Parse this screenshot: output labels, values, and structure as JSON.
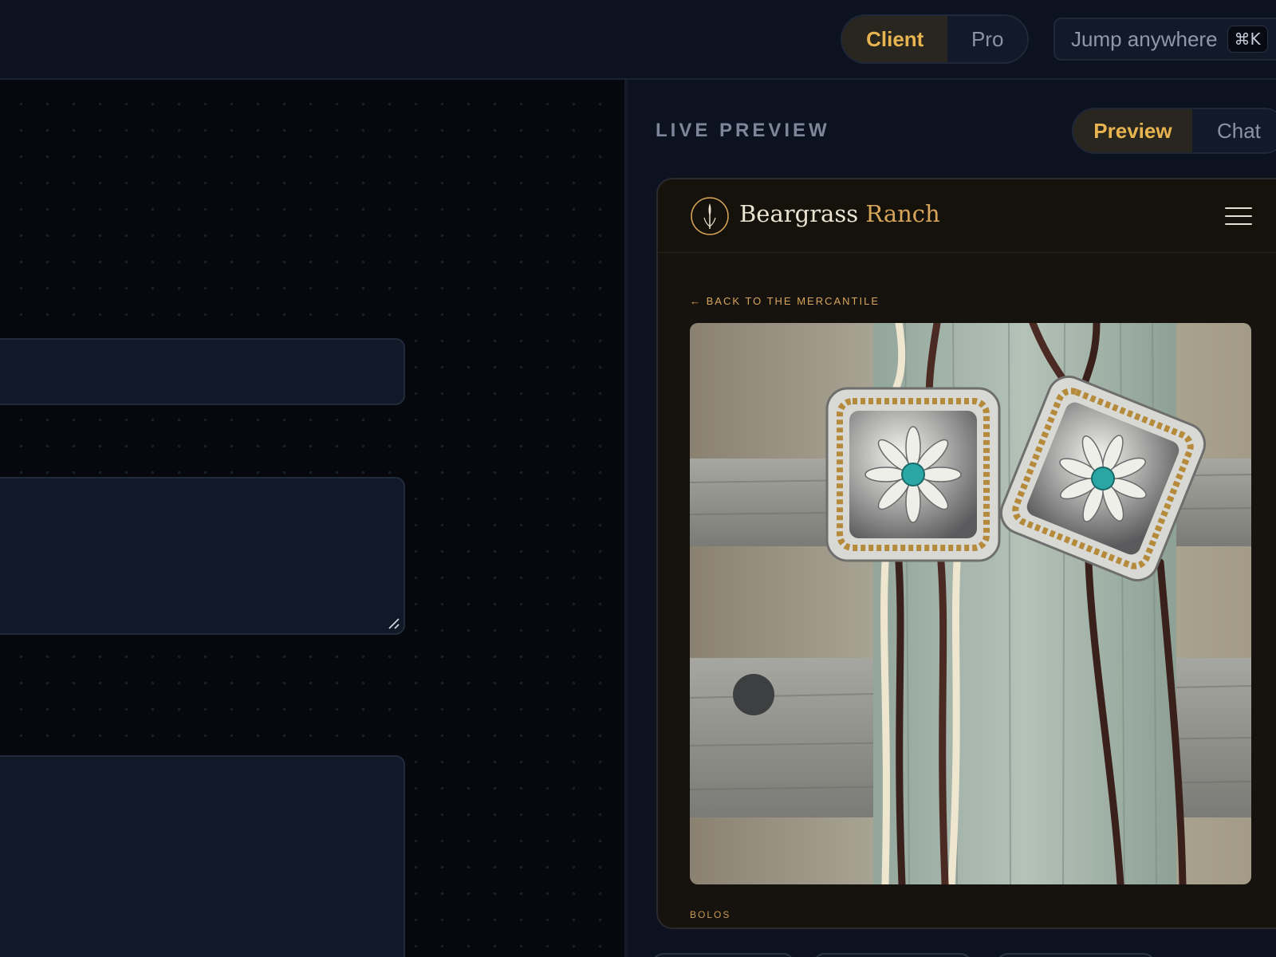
{
  "topbar": {
    "mode_toggle": {
      "active": "Client",
      "inactive": "Pro"
    },
    "jump": {
      "placeholder": "Jump anywhere",
      "shortcut": "⌘K"
    }
  },
  "preview": {
    "label": "LIVE PREVIEW",
    "view_toggle": {
      "active": "Preview",
      "inactive": "Chat"
    },
    "site": {
      "brand_name": "Beargrass",
      "brand_accent": "Ranch",
      "back_link": "← BACK TO THE MERCANTILE",
      "product_image_subject": "two silver bolo ties with turquoise flower conchos on a weathered fence post",
      "category": "BOLOS"
    }
  },
  "colors": {
    "accent_gold": "#e8b450",
    "brand_gold": "#d8a65a",
    "background": "#0b101b",
    "panel": "#111827"
  },
  "icons": {
    "logo": "beargrass-logo-icon",
    "menu": "hamburger-menu-icon",
    "resize": "resize-grip-icon"
  }
}
